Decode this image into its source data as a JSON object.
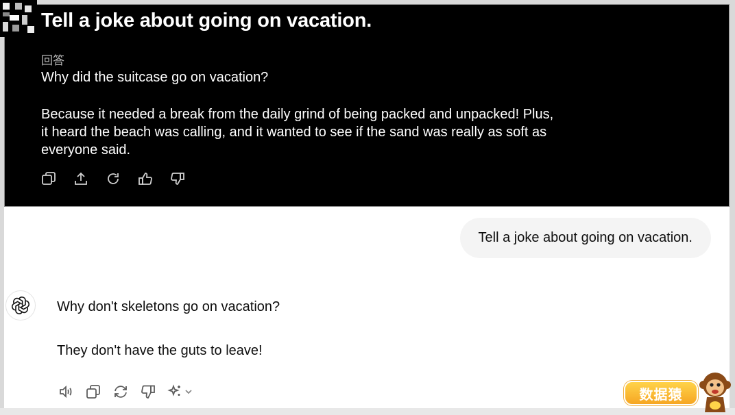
{
  "dark_panel": {
    "title": "Tell a joke about going on vacation.",
    "answer_label": "回答",
    "question_line": "Why did the suitcase go on vacation?",
    "answer_text": "Because it needed a break from the daily grind of being packed and unpacked! Plus, it heard the beach was calling, and it wanted to see if the sand was really as soft as everyone said.",
    "actions": [
      "copy-icon",
      "share-icon",
      "regenerate-icon",
      "thumbs-up-icon",
      "thumbs-down-icon"
    ]
  },
  "chat": {
    "user_message": "Tell a joke about going on vacation.",
    "assistant": {
      "line1": "Why don't skeletons go on vacation?",
      "line2": "They don't have the guts to leave!"
    },
    "actions": [
      "read-aloud-icon",
      "copy-icon",
      "regenerate-icon",
      "thumbs-down-icon",
      "sparkle-model-icon",
      "chevron-down-icon"
    ]
  },
  "watermark": {
    "text": "数据猿"
  },
  "colors": {
    "dark_bg": "#000000",
    "bubble_bg": "#f4f4f4",
    "badge": "#f6a623"
  }
}
